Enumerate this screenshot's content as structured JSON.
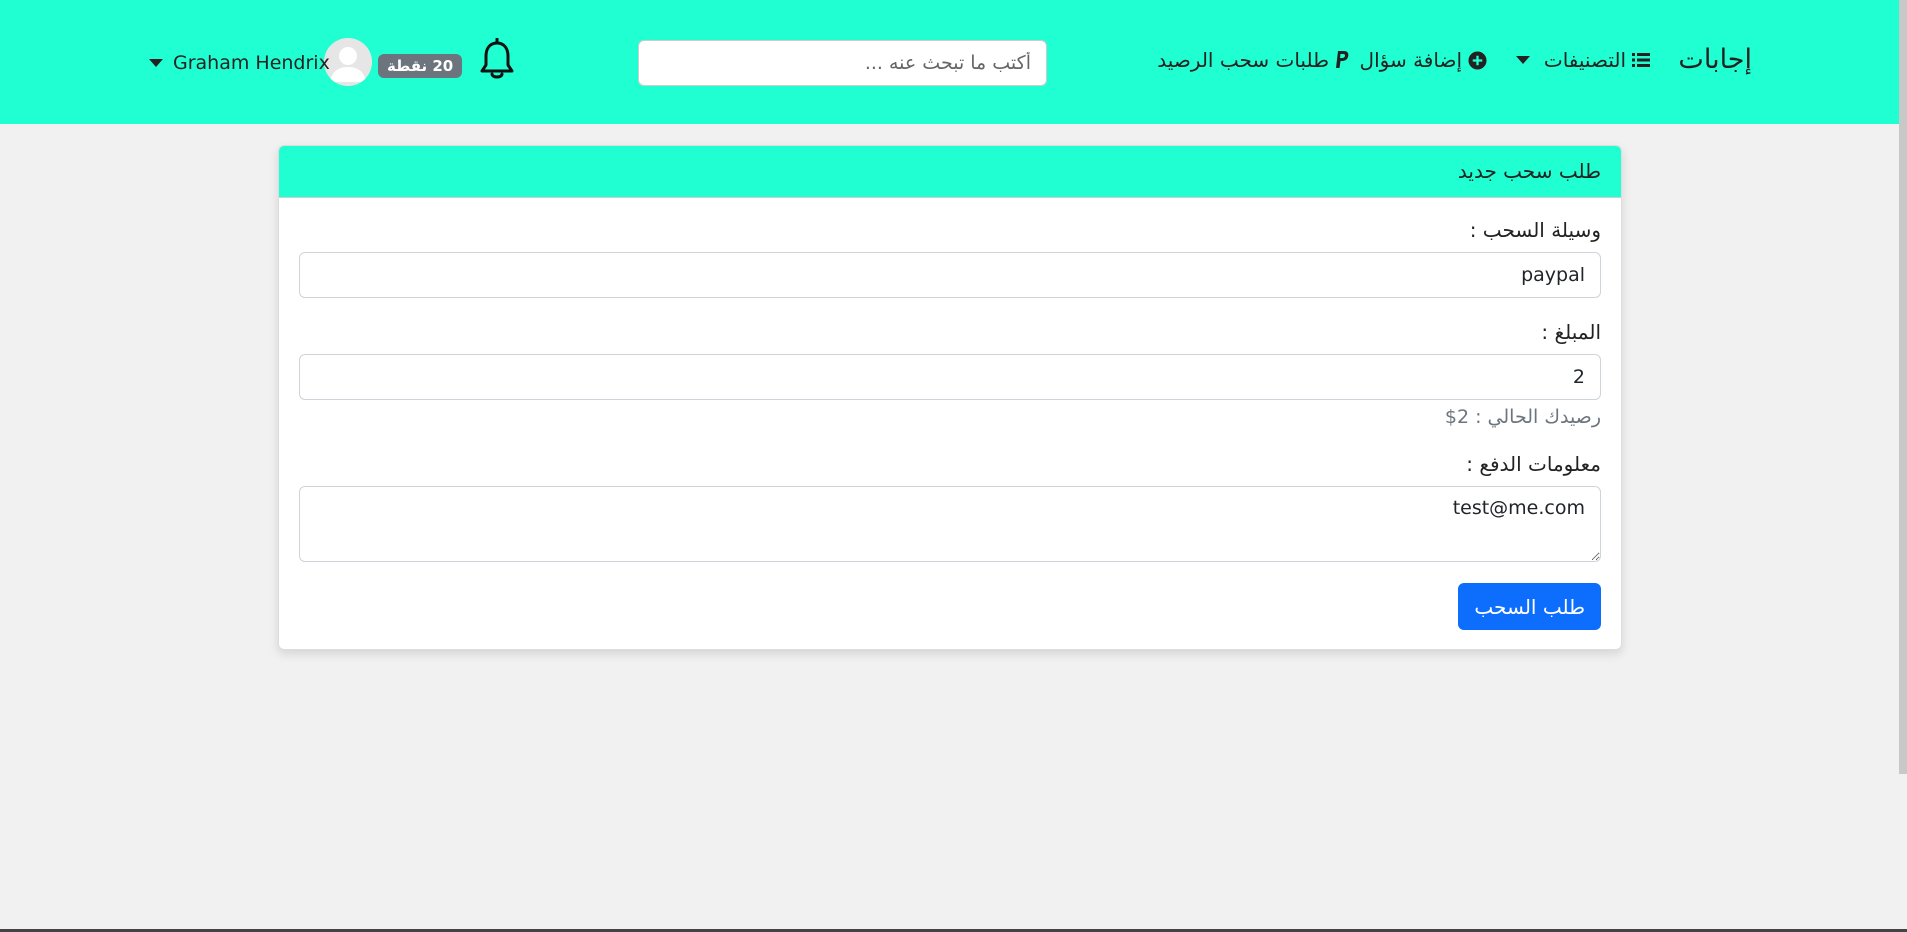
{
  "navbar": {
    "brand": "إجابات",
    "categories_label": "التصنيفات",
    "add_question_label": "إضافة سؤال",
    "withdrawals_label": "طلبات سحب الرصيد",
    "search_placeholder": "أكتب ما تبحث عنه ...",
    "points_badge": "20 نقطة",
    "username": "Graham Hendrix",
    "accent_color": "#20ffd2"
  },
  "card": {
    "title": "طلب سحب جديد",
    "method_label": "وسيلة السحب :",
    "method_value": "paypal",
    "amount_label": "المبلغ :",
    "amount_value": "2",
    "balance_text": "رصيدك الحالي : 2$",
    "payment_info_label": "معلومات الدفع :",
    "payment_info_value": "test@me.com",
    "submit_label": "طلب السحب",
    "button_color": "#0d6efd"
  },
  "icons": {
    "categories": "list-icon",
    "add_question": "plus-circle-icon",
    "withdrawals": "paypal-icon",
    "notifications": "bell-icon",
    "avatar": "user-avatar-icon",
    "dropdown": "caret-down-icon"
  }
}
